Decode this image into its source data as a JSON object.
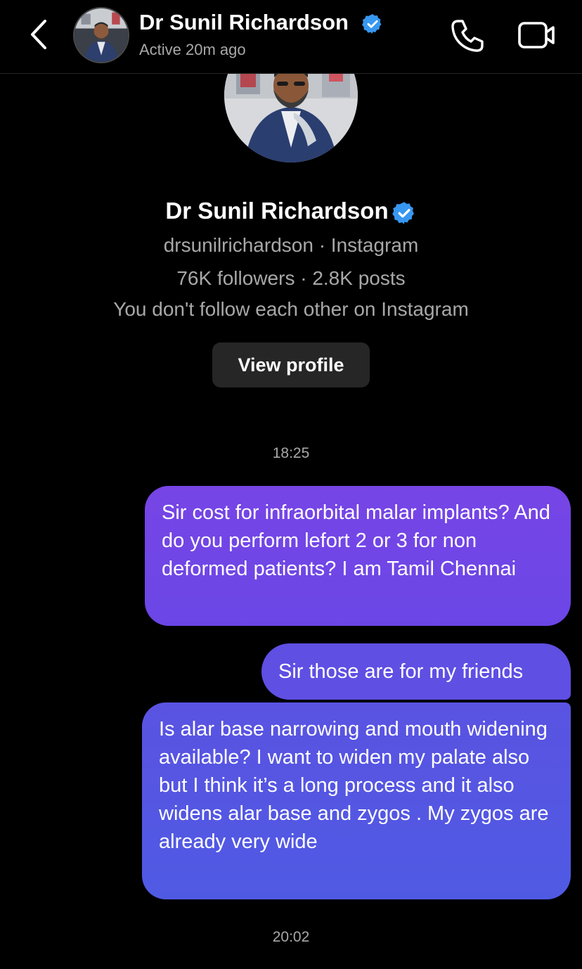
{
  "header": {
    "name": "Dr Sunil Richardson",
    "status": "Active 20m ago"
  },
  "profile": {
    "name": "Dr Sunil Richardson",
    "handle_line": "drsunilrichardson · Instagram",
    "stats_line": "76K followers · 2.8K posts",
    "relation_line": "You don't follow each other on Instagram",
    "view_profile_label": "View profile"
  },
  "conversation": {
    "timestamp_1": "18:25",
    "messages": [
      {
        "text": "Sir cost for infraorbital malar implants? And do you perform lefort 2 or 3 for non deformed patients? I am Tamil Chennai"
      },
      {
        "text": "Sir those are for my friends"
      },
      {
        "text": "Is alar base narrowing and mouth widening available? I want to widen my palate also but I think it’s a long process and it also widens alar base and zygos . My zygos are already very wide"
      }
    ],
    "timestamp_2": "20:02"
  },
  "colors": {
    "background": "#000000",
    "verified": "#3897f0",
    "bubble_top": "#7745e6",
    "bubble_bottom": "#4f5ae3",
    "button_bg": "#262626",
    "secondary_text": "#a8a8a8"
  },
  "icons": {
    "back": "chevron-left-icon",
    "verified": "verified-badge-icon",
    "call": "phone-icon",
    "video": "video-camera-icon"
  }
}
